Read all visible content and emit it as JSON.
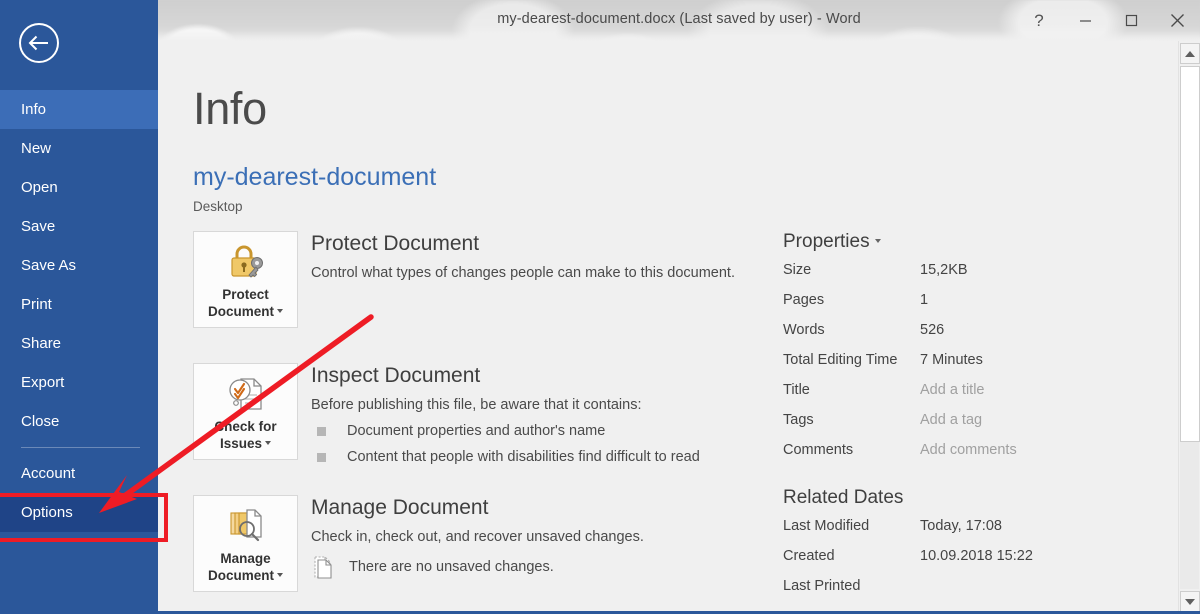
{
  "window": {
    "title": "my-dearest-document.docx (Last saved by user) - Word",
    "help_icon": "?",
    "minimize_icon": "minimize-icon",
    "maximize_icon": "maximize-icon",
    "close_icon": "close-icon",
    "accent_color": "#2b579a"
  },
  "sidebar": {
    "back_icon": "back-arrow-icon",
    "items": [
      {
        "label": "Info",
        "state": "active"
      },
      {
        "label": "New",
        "state": "normal"
      },
      {
        "label": "Open",
        "state": "normal"
      },
      {
        "label": "Save",
        "state": "normal"
      },
      {
        "label": "Save As",
        "state": "normal"
      },
      {
        "label": "Print",
        "state": "normal"
      },
      {
        "label": "Share",
        "state": "normal"
      },
      {
        "label": "Export",
        "state": "normal"
      },
      {
        "label": "Close",
        "state": "normal"
      },
      {
        "label": "Account",
        "state": "normal"
      },
      {
        "label": "Options",
        "state": "highlighted"
      }
    ]
  },
  "annotation": {
    "highlight_color": "#ee1c25",
    "target": "Options",
    "shapes": [
      "red-rectangle",
      "red-arrow"
    ]
  },
  "main": {
    "page_title": "Info",
    "document_name": "my-dearest-document",
    "document_path": "Desktop",
    "sections": [
      {
        "tile_label_line1": "Protect",
        "tile_label_line2": "Document",
        "tile_icon": "padlock-key-icon",
        "title": "Protect Document",
        "description": "Control what types of changes people can make to this document.",
        "bullets": [],
        "note": null
      },
      {
        "tile_label_line1": "Check for",
        "tile_label_line2": "Issues",
        "tile_icon": "document-inspect-icon",
        "title": "Inspect Document",
        "description": "Before publishing this file, be aware that it contains:",
        "bullets": [
          "Document properties and author's name",
          "Content that people with disabilities find difficult to read"
        ],
        "note": null
      },
      {
        "tile_label_line1": "Manage",
        "tile_label_line2": "Document",
        "tile_icon": "manage-versions-icon",
        "title": "Manage Document",
        "description": "Check in, check out, and recover unsaved changes.",
        "bullets": [],
        "note": "There are no unsaved changes.",
        "note_icon": "unsaved-changes-icon"
      }
    ],
    "properties": {
      "heading": "Properties",
      "rows": [
        {
          "key": "Size",
          "value": "15,2KB",
          "placeholder": false
        },
        {
          "key": "Pages",
          "value": "1",
          "placeholder": false
        },
        {
          "key": "Words",
          "value": "526",
          "placeholder": false
        },
        {
          "key": "Total Editing Time",
          "value": "7 Minutes",
          "placeholder": false
        },
        {
          "key": "Title",
          "value": "Add a title",
          "placeholder": true
        },
        {
          "key": "Tags",
          "value": "Add a tag",
          "placeholder": true
        },
        {
          "key": "Comments",
          "value": "Add comments",
          "placeholder": true
        }
      ]
    },
    "related_dates": {
      "heading": "Related Dates",
      "rows": [
        {
          "key": "Last Modified",
          "value": "Today, 17:08",
          "placeholder": false
        },
        {
          "key": "Created",
          "value": "10.09.2018 15:22",
          "placeholder": false
        },
        {
          "key": "Last Printed",
          "value": "",
          "placeholder": false
        }
      ]
    }
  },
  "scrollbar": {
    "up_icon": "scroll-up-arrow-icon",
    "down_icon": "scroll-down-arrow-icon"
  }
}
